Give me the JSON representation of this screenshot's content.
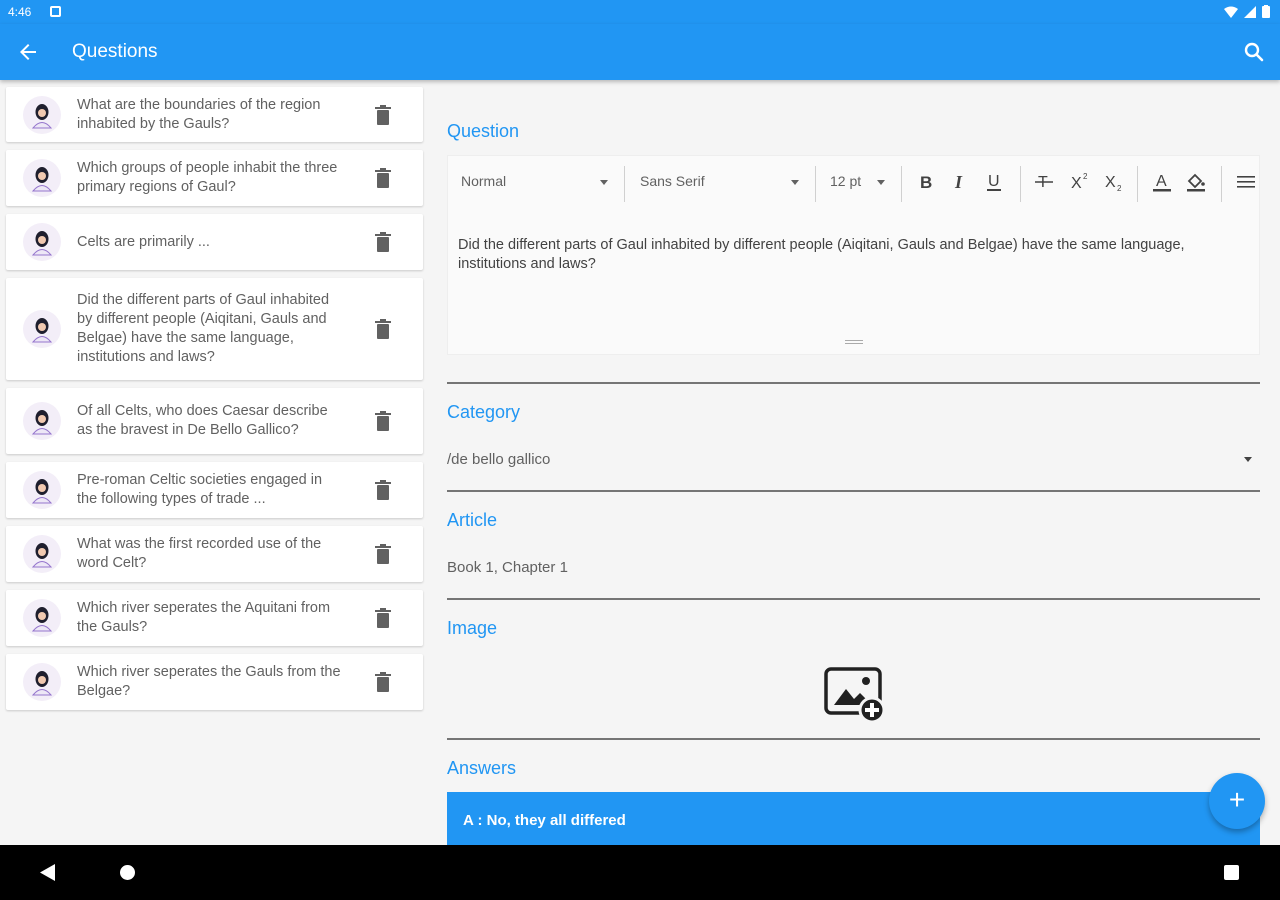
{
  "status_bar": {
    "time": "4:46"
  },
  "app_bar": {
    "title": "Questions"
  },
  "questions": [
    {
      "text": "What are the boundaries of the region inhabited by the Gauls?"
    },
    {
      "text": "Which groups of people inhabit the three primary regions of Gaul?"
    },
    {
      "text": "Celts are primarily ..."
    },
    {
      "text": "Did the different parts of Gaul inhabited by different people (Aiqitani, Gauls and Belgae) have the same language, institutions and laws?"
    },
    {
      "text": "Of all Celts, who does Caesar describe as the bravest in De Bello Gallico?"
    },
    {
      "text": "Pre-roman Celtic societies engaged in the following types of trade ..."
    },
    {
      "text": "What was the first recorded use of the word Celt?"
    },
    {
      "text": "Which river seperates the Aquitani from the Gauls?"
    },
    {
      "text": "Which river seperates the Gauls from the Belgae?"
    }
  ],
  "form": {
    "question_label": "Question",
    "toolbar": {
      "style": "Normal",
      "font": "Sans Serif",
      "size": "12 pt"
    },
    "question_text": "Did the different parts of Gaul inhabited by different people (Aiqitani, Gauls and Belgae) have the same language, institutions and laws?",
    "category_label": "Category",
    "category_value": "/de bello gallico",
    "article_label": "Article",
    "article_value": "Book 1, Chapter 1",
    "image_label": "Image",
    "answers_label": "Answers",
    "answers": [
      {
        "text": "A : No, they all differed"
      }
    ]
  },
  "colors": {
    "primary": "#2196f3",
    "background": "#f5f5f5"
  }
}
